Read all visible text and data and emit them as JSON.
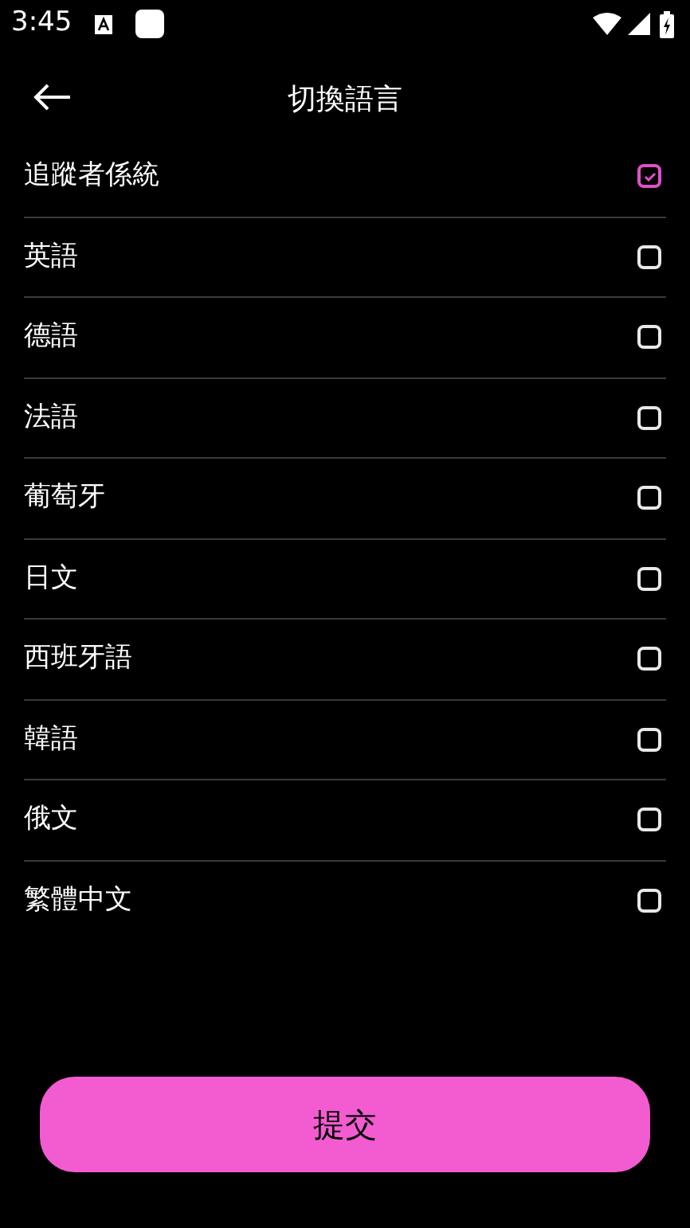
{
  "status_bar": {
    "time": "3:45"
  },
  "header": {
    "title": "切換語言"
  },
  "languages": [
    {
      "label": "追蹤者係統",
      "checked": true
    },
    {
      "label": "英語",
      "checked": false
    },
    {
      "label": "德語",
      "checked": false
    },
    {
      "label": "法語",
      "checked": false
    },
    {
      "label": "葡萄牙",
      "checked": false
    },
    {
      "label": "日文",
      "checked": false
    },
    {
      "label": "西班牙語",
      "checked": false
    },
    {
      "label": "韓語",
      "checked": false
    },
    {
      "label": "俄文",
      "checked": false
    },
    {
      "label": "繁體中文",
      "checked": false
    }
  ],
  "submit_button": {
    "label": "提交"
  }
}
